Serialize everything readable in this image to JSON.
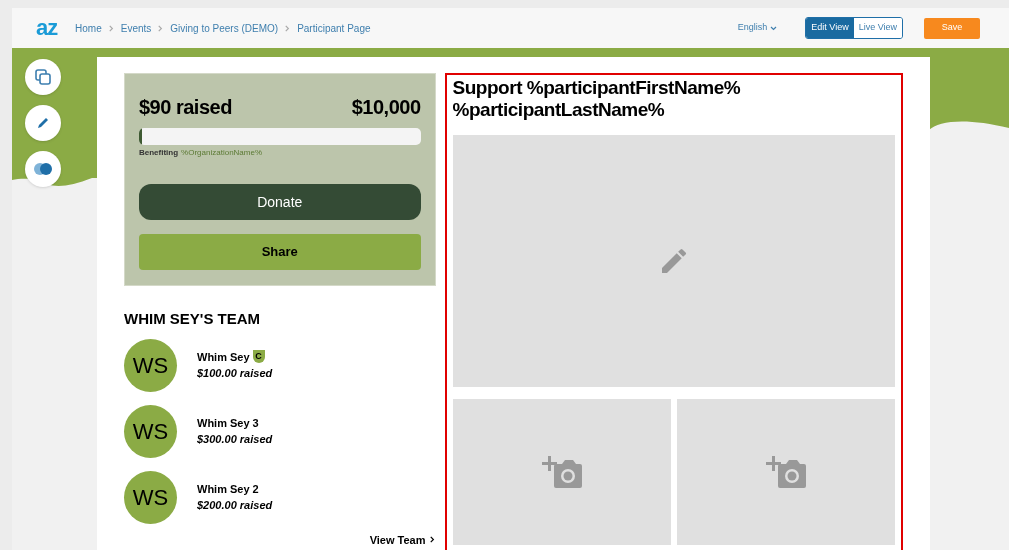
{
  "header": {
    "logo": "az",
    "breadcrumbs": [
      {
        "label": "Home"
      },
      {
        "label": "Events"
      },
      {
        "label": "Giving to Peers (DEMO)"
      },
      {
        "label": "Participant Page"
      }
    ],
    "language": "English",
    "views": [
      {
        "label": "Edit View",
        "selected": true
      },
      {
        "label": "Live View",
        "selected": false
      }
    ],
    "save": "Save"
  },
  "tools": [
    {
      "kind": "copy"
    },
    {
      "kind": "edit"
    },
    {
      "kind": "toggle"
    }
  ],
  "fundraising": {
    "raised": "$90 raised",
    "goal": "$10,000",
    "level": 0.01,
    "benefiting_label": "Benefiting",
    "organization": "%OrganizationName%",
    "donate": "Donate",
    "share": "Share"
  },
  "team": {
    "title": "WHIM SEY'S TEAM",
    "members": [
      {
        "initials": "WS",
        "name": "Whim Sey",
        "badge": "C",
        "raised": "$100.00 raised"
      },
      {
        "initials": "WS",
        "name": "Whim Sey 3",
        "raised": "$300.00 raised"
      },
      {
        "initials": "WS",
        "name": "Whim Sey 2",
        "raised": "$200.00 raised"
      }
    ],
    "view_team": "View Team"
  },
  "story": {
    "title": "Support %participantFirstName% %participantLastName%",
    "main_photo": {
      "kind": "edit"
    },
    "photos": [
      {
        "kind": "add-photo"
      },
      {
        "kind": "add-photo"
      }
    ]
  }
}
